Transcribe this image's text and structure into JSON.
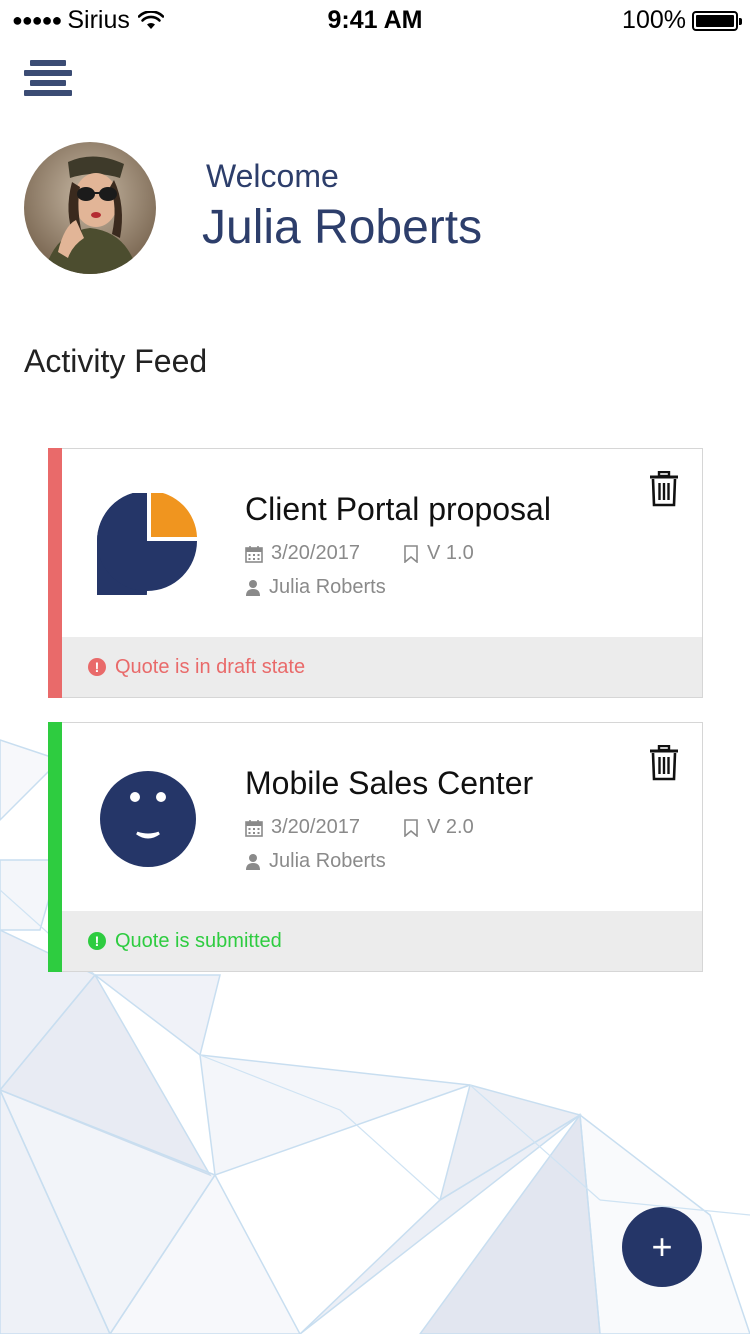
{
  "status_bar": {
    "signal_dots": "●●●●●",
    "carrier": "Sirius",
    "time": "9:41 AM",
    "battery": "100%"
  },
  "header": {
    "menu_icon": "hamburger-menu-icon",
    "welcome": "Welcome",
    "user_name": "Julia Roberts"
  },
  "section": {
    "title": "Activity Feed"
  },
  "colors": {
    "navy": "#253668",
    "draft": "#e96a6a",
    "submitted": "#2ecc40",
    "orange": "#f0951f"
  },
  "cards": [
    {
      "title": "Client Portal proposal",
      "date": "3/20/2017",
      "version": "V 1.0",
      "owner": "Julia Roberts",
      "status": "Quote is in draft state",
      "icon": "pie-chart-icon"
    },
    {
      "title": "Mobile Sales Center",
      "date": "3/20/2017",
      "version": "V 2.0",
      "owner": "Julia Roberts",
      "status": "Quote is submitted",
      "icon": "smiley-face-icon"
    }
  ],
  "fab": {
    "label": "+"
  }
}
